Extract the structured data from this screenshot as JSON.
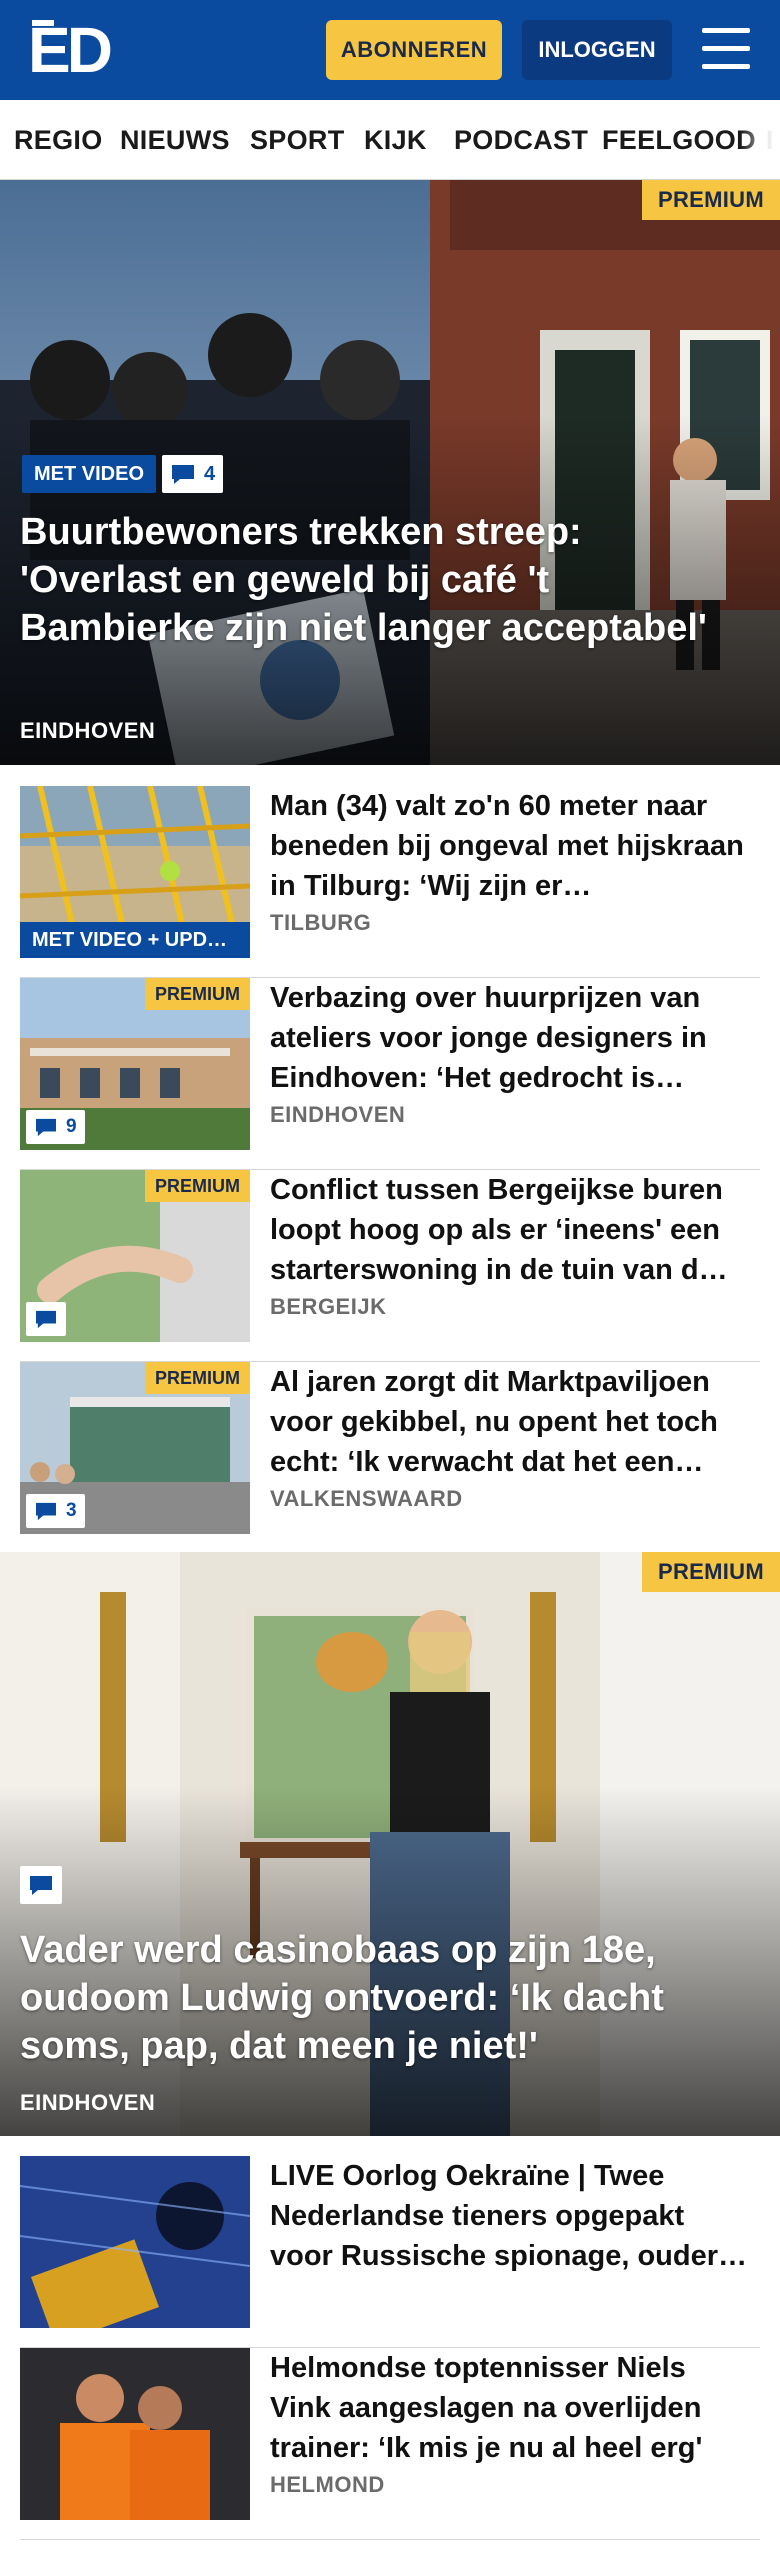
{
  "header": {
    "logo_text": "ED",
    "subscribe_label": "ABONNEREN",
    "login_label": "INLOGGEN",
    "menu_icon": "hamburger-menu-icon",
    "brand_color": "#0a4ba0",
    "accent_color": "#f6c643"
  },
  "nav": {
    "items": [
      "REGIO",
      "NIEUWS",
      "SPORT",
      "KIJK",
      "PODCAST",
      "FEELGOOD",
      "I"
    ]
  },
  "hero1": {
    "premium": "PREMIUM",
    "video_label": "MET VIDEO",
    "comments": "4",
    "title": "Buurtbewoners trekken streep: 'Overlast en geweld bij café 't Bambierke zijn niet langer acceptabel'",
    "location": "EINDHOVEN"
  },
  "articles": [
    {
      "title": "Man (34) valt zo'n 60 meter naar beneden bij ongeval met hijskraan in Tilburg: ‘Wij zijn er…",
      "location": "TILBURG",
      "video_label": "MET VIDEO + UPD…"
    },
    {
      "title": "Verbazing over huurprijzen van ateliers voor jonge designers in Eindhoven: ‘Het gedrocht is…",
      "location": "EINDHOVEN",
      "premium": "PREMIUM",
      "comments": "9"
    },
    {
      "title": "Conflict tussen Bergeijkse buren loopt hoog op als er ‘ineens' een starterswoning in de tuin van d…",
      "location": "BERGEIJK",
      "premium": "PREMIUM"
    },
    {
      "title": "Al jaren zorgt dit Marktpaviljoen voor gekibbel, nu opent het toch echt: ‘Ik verwacht dat het een…",
      "location": "VALKENSWAARD",
      "premium": "PREMIUM",
      "comments": "3"
    }
  ],
  "hero2": {
    "premium": "PREMIUM",
    "title": "Vader werd casinobaas op zijn 18e, oudoom Ludwig ontvoerd: ‘Ik dacht soms, pap, dat meen je niet!'",
    "location": "EINDHOVEN"
  },
  "articles2": [
    {
      "title": "LIVE Oorlog Oekraïne | Twee Nederlandse tieners opgepakt voor Russische spionage, ouder…",
      "location": ""
    },
    {
      "title": "Helmondse toptennisser Niels Vink aangeslagen na overlijden trainer: ‘Ik mis je nu al heel erg'",
      "location": "HELMOND"
    }
  ]
}
